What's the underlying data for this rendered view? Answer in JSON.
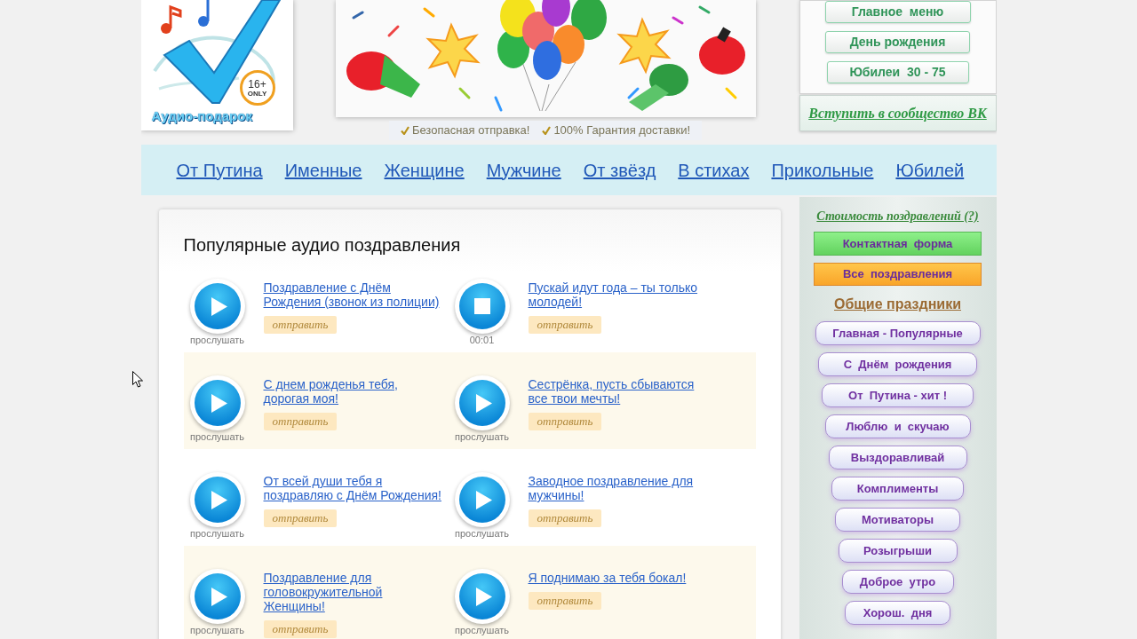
{
  "logo": {
    "title": "Аудио-подарок",
    "badge": "16+",
    "badge_caption": "ONLY"
  },
  "guarantees": [
    "Безопасная отправка!",
    "100% Гарантия доставки!"
  ],
  "top_menu": [
    "Главное  меню",
    "День рождения",
    "Юбилеи  30 - 75"
  ],
  "community_link": "Вступить в сообщество ВК",
  "nav": [
    "От Путина",
    "Именные",
    "Женщине",
    "Мужчине",
    "От звёзд",
    "В стихах",
    "Прикольные",
    "Юбилей"
  ],
  "main": {
    "title": "Популярные аудио поздравления",
    "items": [
      {
        "title": "Поздравление с Днём Рождения (звонок из полиции)",
        "playing": false,
        "caption": "прослушать",
        "send": "отправить"
      },
      {
        "title": "Пускай идут года – ты только молодей!",
        "playing": true,
        "caption": "00:01",
        "send": "отправить"
      },
      {
        "title": "С днем рожденья тебя, дорогая моя!",
        "playing": false,
        "caption": "прослушать",
        "send": "отправить"
      },
      {
        "title": "Сестрёнка, пусть сбываются все твои мечты!",
        "playing": false,
        "caption": "прослушать",
        "send": "отправить"
      },
      {
        "title": "От всей души тебя я поздравляю с Днём Рождения!",
        "playing": false,
        "caption": "прослушать",
        "send": "отправить"
      },
      {
        "title": "Заводное поздравление для мужчины!",
        "playing": false,
        "caption": "прослушать",
        "send": "отправить"
      },
      {
        "title": "Поздравление для головокружительной Женщины!",
        "playing": false,
        "caption": "прослушать",
        "send": "отправить"
      },
      {
        "title": "Я поднимаю за тебя бокал!",
        "playing": false,
        "caption": "прослушать",
        "send": "отправить"
      }
    ]
  },
  "sidebar": {
    "price_link": "Стоимость поздравлений (?)",
    "buttons": [
      {
        "label": "Контактная  форма",
        "kind": "contact"
      },
      {
        "label": "Все  поздравления",
        "kind": "all"
      }
    ],
    "section_title": "Общие праздники",
    "categories": [
      "Главная - Популярные",
      "С  Днём  рождения",
      "От  Путина - хит !",
      "Люблю  и  скучаю",
      "Выздоравливай",
      "Комплименты",
      "Мотиваторы",
      "Розыгрыши",
      "Доброе  утро",
      "Хорош.  дня"
    ]
  }
}
